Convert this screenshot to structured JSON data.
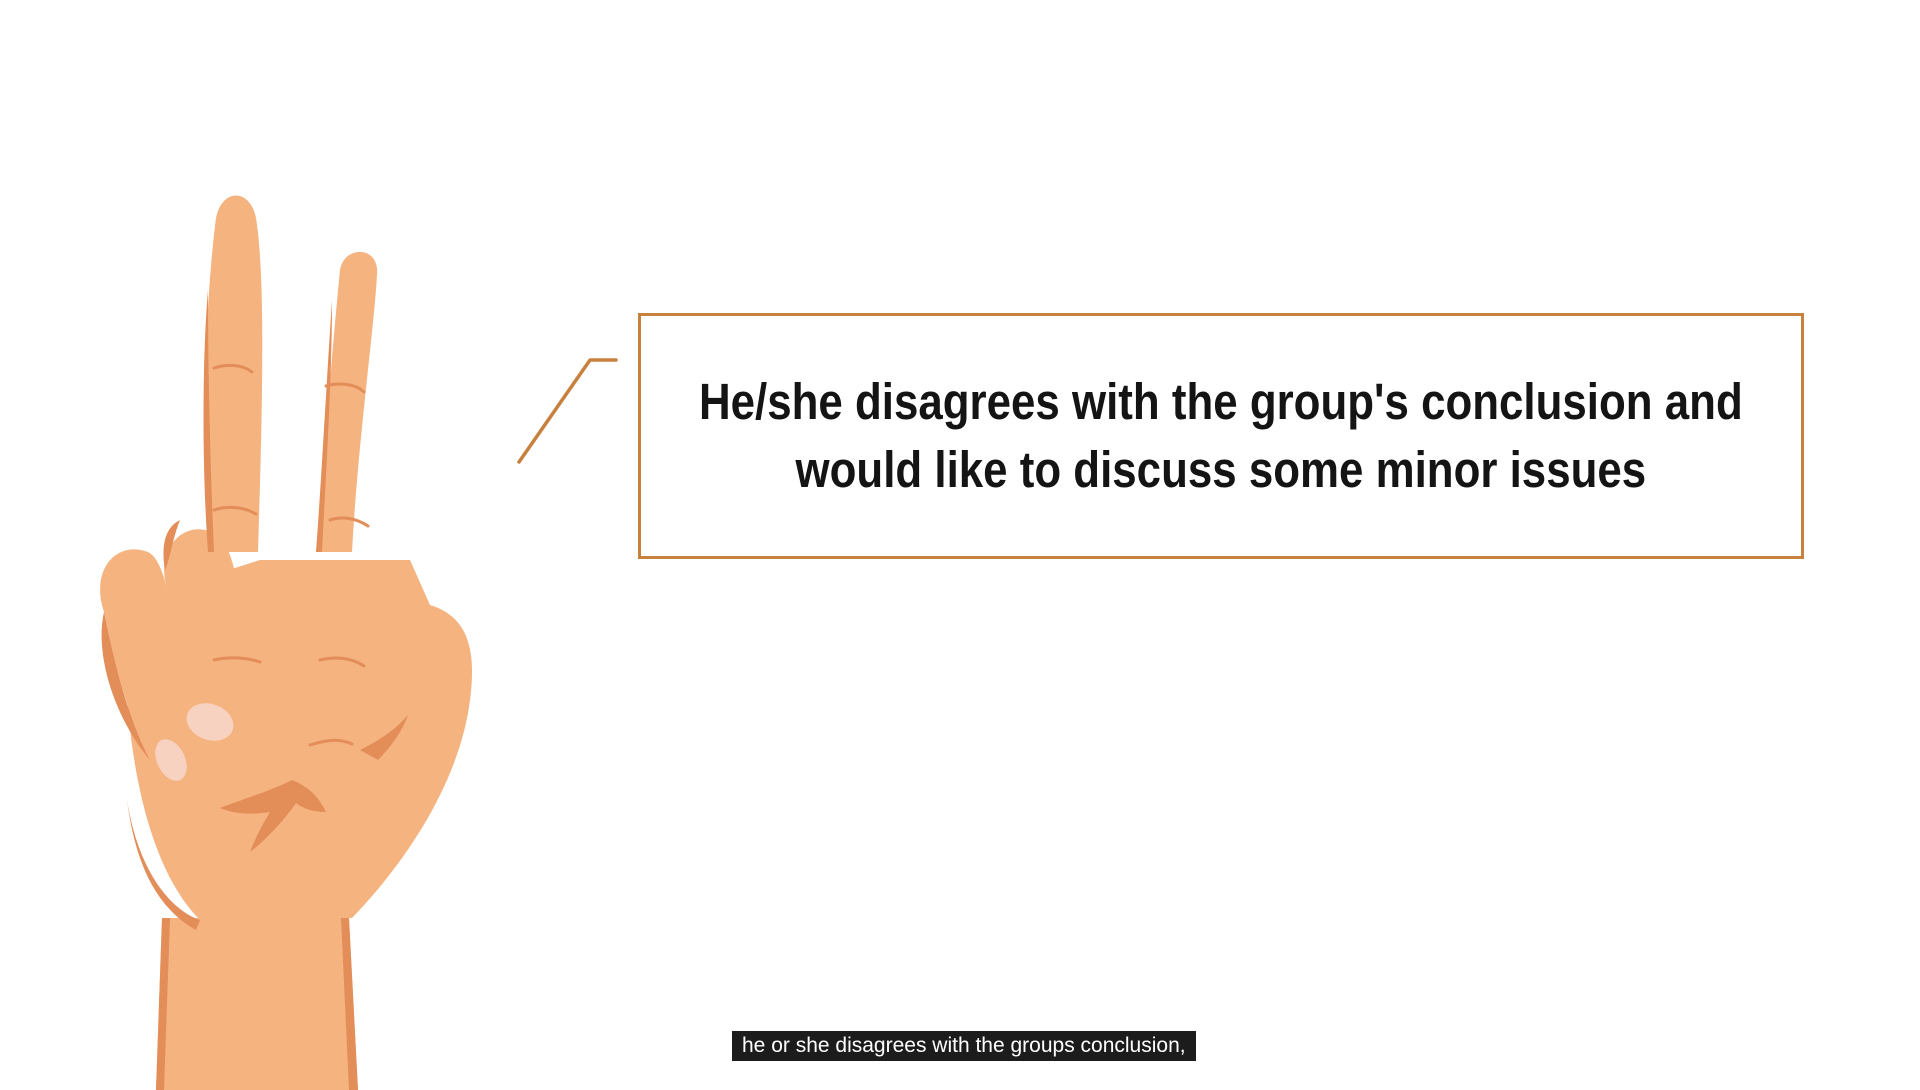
{
  "caption": {
    "line1": "He/she disagrees with the group's conclusion and",
    "line2": "would like to discuss some minor issues"
  },
  "subtitle": "he or she disagrees with the groups conclusion,",
  "colors": {
    "skin": "#f5b380",
    "skin_shadow": "#e38d59",
    "nail": "#f8d2c0",
    "box_border": "#c8803e",
    "subtitle_bg": "#1c1c1c"
  },
  "icons": {
    "hand": "two-fingers-hand-icon"
  }
}
